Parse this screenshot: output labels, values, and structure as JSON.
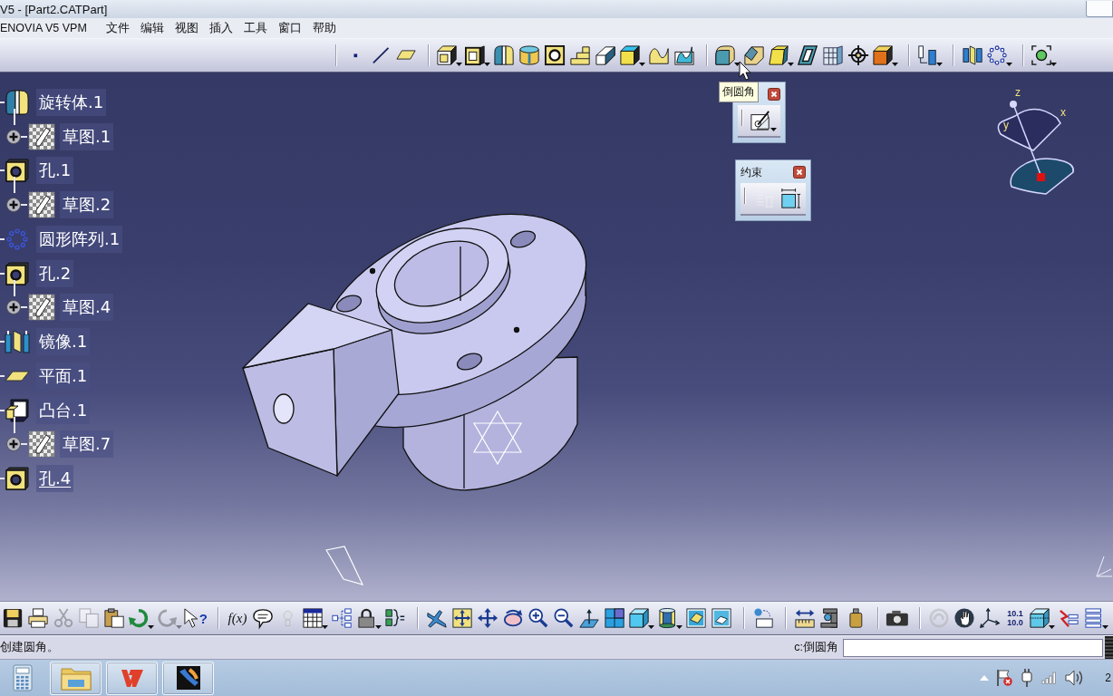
{
  "window": {
    "title": "V5 - [Part2.CATPart]"
  },
  "menu_bar": [
    "ENOVIA V5 VPM",
    "文件",
    "编辑",
    "视图",
    "插入",
    "工具",
    "窗口",
    "帮助"
  ],
  "top_toolbar": [
    [
      {
        "has_menu": false
      },
      {
        "has_menu": false
      },
      {
        "has_menu": false
      }
    ],
    [
      {
        "has_menu": true
      },
      {
        "has_menu": true
      },
      {
        "has_menu": false
      },
      {
        "has_menu": false
      },
      {
        "has_menu": false
      },
      {
        "has_menu": false
      },
      {
        "has_menu": false
      },
      {
        "has_menu": true
      },
      {
        "has_menu": false
      },
      {
        "has_menu": false
      }
    ],
    [
      {
        "has_menu": true
      },
      {
        "has_menu": false
      },
      {
        "has_menu": true
      },
      {
        "has_menu": false
      },
      {
        "has_menu": false
      },
      {
        "has_menu": false
      },
      {
        "has_menu": true
      }
    ],
    [
      {
        "has_menu": true
      }
    ],
    [
      {
        "has_menu": false
      },
      {
        "has_menu": true
      }
    ],
    [
      {
        "has_menu": true
      }
    ]
  ],
  "tree": {
    "items": [
      {
        "kind": "revolve",
        "label": "旋转体.1",
        "in_work": false,
        "children": [
          {
            "kind": "sketch",
            "label": "草图.1",
            "in_work": false,
            "expanded": false
          }
        ]
      },
      {
        "kind": "hole",
        "label": "孔.1",
        "in_work": false,
        "children": [
          {
            "kind": "sketch",
            "label": "草图.2",
            "in_work": false,
            "expanded": false
          }
        ]
      },
      {
        "kind": "pattern",
        "label": "圆形阵列.1",
        "in_work": false
      },
      {
        "kind": "hole",
        "label": "孔.2",
        "in_work": false,
        "children": [
          {
            "kind": "sketch",
            "label": "草图.4",
            "in_work": false,
            "expanded": false
          }
        ]
      },
      {
        "kind": "mirror",
        "label": "镜像.1",
        "in_work": false
      },
      {
        "kind": "plane",
        "label": "平面.1",
        "in_work": false
      },
      {
        "kind": "pad",
        "label": "凸台.1",
        "in_work": false,
        "children": [
          {
            "kind": "sketch",
            "label": "草图.7",
            "in_work": false,
            "expanded": false
          }
        ]
      },
      {
        "kind": "hole",
        "label": "孔.4",
        "in_work": true
      }
    ]
  },
  "tooltip": {
    "text": "倒圆角"
  },
  "floating_toolbars": [
    {
      "buttons": [
        {
          "has_menu": true,
          "disabled": false
        }
      ]
    },
    {
      "title": "约束",
      "buttons": [
        {
          "has_menu": false,
          "disabled": true
        },
        {
          "has_menu": false,
          "disabled": false
        }
      ]
    }
  ],
  "compass": {
    "axes": [
      {
        "label": "z"
      },
      {
        "label": "x"
      },
      {
        "label": "y"
      }
    ]
  },
  "bottom_toolbar": [
    [
      {
        "has_menu": false,
        "disabled": false
      },
      {
        "has_menu": false,
        "disabled": false
      },
      {
        "has_menu": false,
        "disabled": true
      },
      {
        "has_menu": false,
        "disabled": true
      },
      {
        "has_menu": false,
        "disabled": false
      },
      {
        "has_menu": true,
        "disabled": false
      },
      {
        "has_menu": true,
        "disabled": true
      },
      {
        "has_menu": false,
        "disabled": false,
        "glyph": "?"
      }
    ],
    [
      {
        "has_menu": false,
        "disabled": false,
        "glyph": "f(x)"
      },
      {
        "has_menu": false,
        "disabled": false
      },
      {
        "has_menu": false,
        "disabled": true
      },
      {
        "has_menu": true,
        "disabled": false
      },
      {
        "has_menu": false,
        "disabled": false
      },
      {
        "has_menu": true,
        "disabled": false
      },
      {
        "has_menu": false,
        "disabled": false
      }
    ],
    [
      {
        "has_menu": false,
        "disabled": false
      },
      {
        "has_menu": false,
        "disabled": false
      },
      {
        "has_menu": false,
        "disabled": false
      },
      {
        "has_menu": false,
        "disabled": false
      },
      {
        "has_menu": false,
        "disabled": false
      },
      {
        "has_menu": false,
        "disabled": false
      },
      {
        "has_menu": false,
        "disabled": false
      },
      {
        "has_menu": false,
        "disabled": false
      },
      {
        "has_menu": true,
        "disabled": false
      },
      {
        "has_menu": true,
        "disabled": false
      },
      {
        "has_menu": false,
        "disabled": false
      },
      {
        "has_menu": false,
        "disabled": false
      }
    ],
    [
      {
        "has_menu": false,
        "disabled": false
      }
    ],
    [
      {
        "has_menu": false,
        "disabled": false
      },
      {
        "has_menu": false,
        "disabled": false
      },
      {
        "has_menu": false,
        "disabled": false
      }
    ],
    [
      {
        "has_menu": false,
        "disabled": false
      }
    ],
    [
      {
        "has_menu": false,
        "disabled": true
      },
      {
        "has_menu": false,
        "disabled": false
      },
      {
        "has_menu": false,
        "disabled": false
      },
      {
        "has_menu": false,
        "disabled": false,
        "glyph_lines": [
          "10.1",
          "10.0"
        ]
      },
      {
        "has_menu": true,
        "disabled": false
      },
      {
        "has_menu": false,
        "disabled": false
      },
      {
        "has_menu": true,
        "disabled": false
      }
    ]
  ],
  "status_bar": {
    "message": "创建圆角。",
    "command_label": "c:倒圆角"
  },
  "taskbar": {
    "apps": [
      {
        "running": false
      },
      {
        "running": true
      },
      {
        "running": true
      },
      {
        "running": true
      }
    ],
    "clock": "2"
  }
}
